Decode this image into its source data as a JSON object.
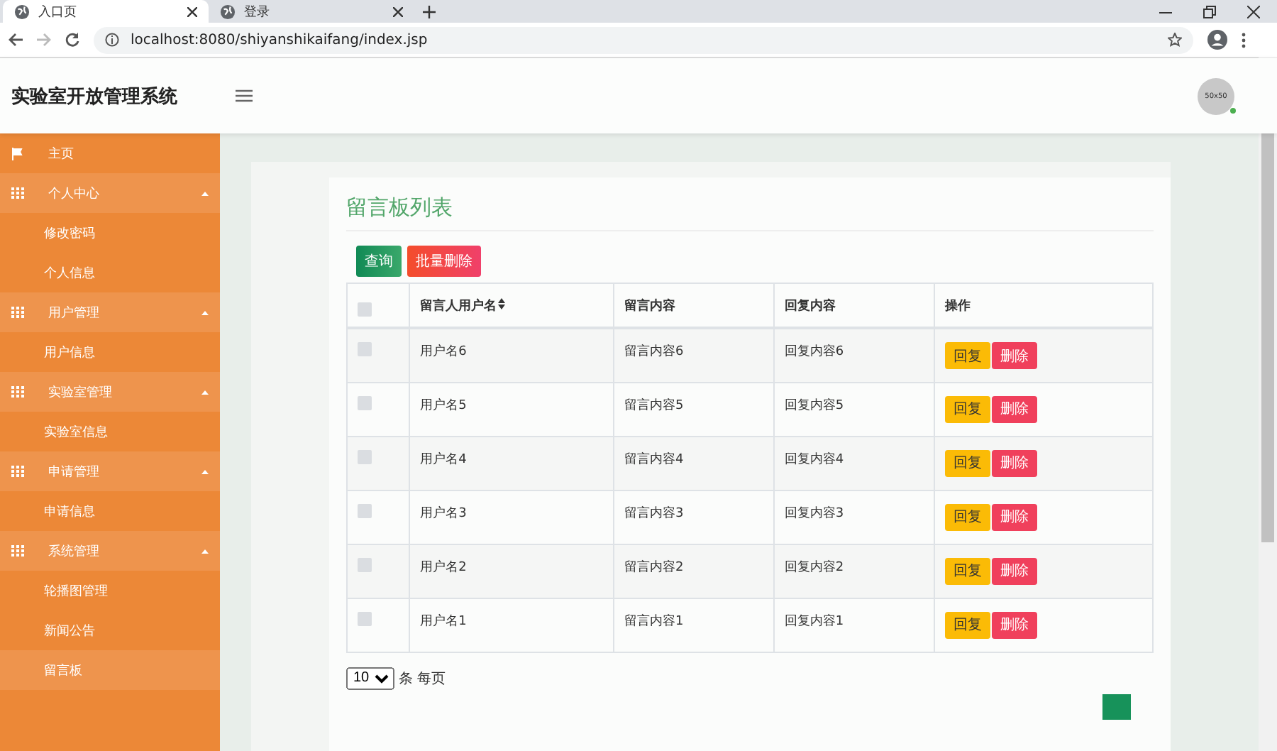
{
  "browser": {
    "tabs": [
      {
        "title": "入口页",
        "selected": true
      },
      {
        "title": "登录",
        "selected": false
      }
    ],
    "address": "localhost:8080/shiyanshikaifang/index.jsp"
  },
  "header": {
    "title": "实验室开放管理系统",
    "avatar_text": "50x50"
  },
  "sidebar": {
    "items": [
      {
        "label": "主页",
        "kind": "home",
        "selected": false
      },
      {
        "label": "个人中心",
        "kind": "group",
        "expanded": true,
        "children": [
          {
            "label": "修改密码",
            "selected": false
          },
          {
            "label": "个人信息",
            "selected": false
          }
        ]
      },
      {
        "label": "用户管理",
        "kind": "group",
        "expanded": true,
        "children": [
          {
            "label": "用户信息",
            "selected": false
          }
        ]
      },
      {
        "label": "实验室管理",
        "kind": "group",
        "expanded": true,
        "children": [
          {
            "label": "实验室信息",
            "selected": false
          }
        ]
      },
      {
        "label": "申请管理",
        "kind": "group",
        "expanded": true,
        "children": [
          {
            "label": "申请信息",
            "selected": false
          }
        ]
      },
      {
        "label": "系统管理",
        "kind": "group",
        "expanded": true,
        "children": [
          {
            "label": "轮播图管理",
            "selected": false
          },
          {
            "label": "新闻公告",
            "selected": false
          },
          {
            "label": "留言板",
            "selected": true
          }
        ]
      }
    ]
  },
  "panel": {
    "title": "留言板列表",
    "buttons": [
      {
        "label": "查询",
        "kind": "search"
      },
      {
        "label": "批量删除",
        "kind": "danger"
      }
    ],
    "table": {
      "all_checked": false,
      "columns": [
        "留言人用户名",
        "留言内容",
        "回复内容",
        "操作"
      ],
      "rows": [
        {
          "checked": false,
          "cells": [
            "用户名6",
            "留言内容6",
            "回复内容6"
          ],
          "actions": [
            "回复",
            "删除"
          ]
        },
        {
          "checked": false,
          "cells": [
            "用户名5",
            "留言内容5",
            "回复内容5"
          ],
          "actions": [
            "回复",
            "删除"
          ]
        },
        {
          "checked": false,
          "cells": [
            "用户名4",
            "留言内容4",
            "回复内容4"
          ],
          "actions": [
            "回复",
            "删除"
          ]
        },
        {
          "checked": false,
          "cells": [
            "用户名3",
            "留言内容3",
            "回复内容3"
          ],
          "actions": [
            "回复",
            "删除"
          ]
        },
        {
          "checked": false,
          "cells": [
            "用户名2",
            "留言内容2",
            "回复内容2"
          ],
          "actions": [
            "回复",
            "删除"
          ]
        },
        {
          "checked": false,
          "cells": [
            "用户名1",
            "留言内容1",
            "回复内容1"
          ],
          "actions": [
            "回复",
            "删除"
          ]
        }
      ]
    },
    "pager": {
      "page_size": "10",
      "suffix": "条 每页"
    }
  }
}
